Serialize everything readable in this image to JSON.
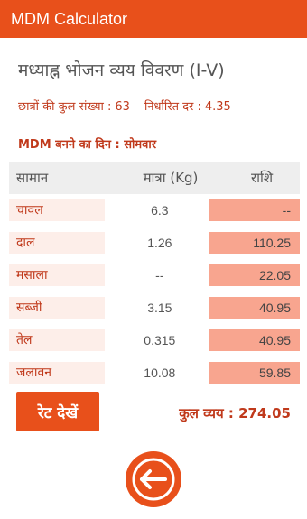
{
  "app": {
    "title": "MDM Calculator"
  },
  "colors": {
    "accent": "#e8501b",
    "text_red": "#c0391b",
    "cell_bg": "#fdeee9",
    "amount_bg": "#f8a58f"
  },
  "heading": "मध्याह्न भोजन व्यय विवरण (I-V)",
  "summary": {
    "students_label": "छात्रों की कुल संख्या :",
    "students_value": "63",
    "rate_label": "निर्धारित दर  :",
    "rate_value": "4.35"
  },
  "day": {
    "label": "MDM बनने का दिन :",
    "value": "सोमवार"
  },
  "table": {
    "headers": [
      "सामान",
      "मात्रा (Kg)",
      "राशि"
    ],
    "rows": [
      {
        "item": "चावल",
        "qty": "6.3",
        "amount": "--"
      },
      {
        "item": "दाल",
        "qty": "1.26",
        "amount": "110.25"
      },
      {
        "item": "मसाला",
        "qty": "--",
        "amount": "22.05"
      },
      {
        "item": "सब्जी",
        "qty": "3.15",
        "amount": "40.95"
      },
      {
        "item": "तेल",
        "qty": "0.315",
        "amount": "40.95"
      },
      {
        "item": "जलावन",
        "qty": "10.08",
        "amount": "59.85"
      }
    ]
  },
  "actions": {
    "rate_button": "रेट देखें",
    "back_icon": "arrow-left-icon"
  },
  "total": {
    "label": "कुल व्यय :",
    "value": "274.05"
  }
}
